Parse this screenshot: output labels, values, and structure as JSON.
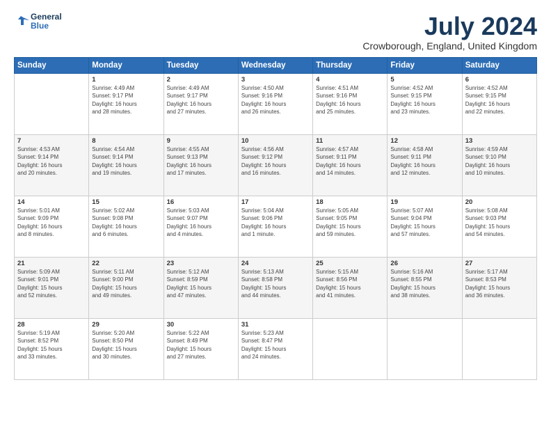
{
  "header": {
    "logo_line1": "General",
    "logo_line2": "Blue",
    "title": "July 2024",
    "subtitle": "Crowborough, England, United Kingdom"
  },
  "columns": [
    "Sunday",
    "Monday",
    "Tuesday",
    "Wednesday",
    "Thursday",
    "Friday",
    "Saturday"
  ],
  "weeks": [
    [
      {
        "day": "",
        "info": ""
      },
      {
        "day": "1",
        "info": "Sunrise: 4:49 AM\nSunset: 9:17 PM\nDaylight: 16 hours\nand 28 minutes."
      },
      {
        "day": "2",
        "info": "Sunrise: 4:49 AM\nSunset: 9:17 PM\nDaylight: 16 hours\nand 27 minutes."
      },
      {
        "day": "3",
        "info": "Sunrise: 4:50 AM\nSunset: 9:16 PM\nDaylight: 16 hours\nand 26 minutes."
      },
      {
        "day": "4",
        "info": "Sunrise: 4:51 AM\nSunset: 9:16 PM\nDaylight: 16 hours\nand 25 minutes."
      },
      {
        "day": "5",
        "info": "Sunrise: 4:52 AM\nSunset: 9:15 PM\nDaylight: 16 hours\nand 23 minutes."
      },
      {
        "day": "6",
        "info": "Sunrise: 4:52 AM\nSunset: 9:15 PM\nDaylight: 16 hours\nand 22 minutes."
      }
    ],
    [
      {
        "day": "7",
        "info": "Sunrise: 4:53 AM\nSunset: 9:14 PM\nDaylight: 16 hours\nand 20 minutes."
      },
      {
        "day": "8",
        "info": "Sunrise: 4:54 AM\nSunset: 9:14 PM\nDaylight: 16 hours\nand 19 minutes."
      },
      {
        "day": "9",
        "info": "Sunrise: 4:55 AM\nSunset: 9:13 PM\nDaylight: 16 hours\nand 17 minutes."
      },
      {
        "day": "10",
        "info": "Sunrise: 4:56 AM\nSunset: 9:12 PM\nDaylight: 16 hours\nand 16 minutes."
      },
      {
        "day": "11",
        "info": "Sunrise: 4:57 AM\nSunset: 9:11 PM\nDaylight: 16 hours\nand 14 minutes."
      },
      {
        "day": "12",
        "info": "Sunrise: 4:58 AM\nSunset: 9:11 PM\nDaylight: 16 hours\nand 12 minutes."
      },
      {
        "day": "13",
        "info": "Sunrise: 4:59 AM\nSunset: 9:10 PM\nDaylight: 16 hours\nand 10 minutes."
      }
    ],
    [
      {
        "day": "14",
        "info": "Sunrise: 5:01 AM\nSunset: 9:09 PM\nDaylight: 16 hours\nand 8 minutes."
      },
      {
        "day": "15",
        "info": "Sunrise: 5:02 AM\nSunset: 9:08 PM\nDaylight: 16 hours\nand 6 minutes."
      },
      {
        "day": "16",
        "info": "Sunrise: 5:03 AM\nSunset: 9:07 PM\nDaylight: 16 hours\nand 4 minutes."
      },
      {
        "day": "17",
        "info": "Sunrise: 5:04 AM\nSunset: 9:06 PM\nDaylight: 16 hours\nand 1 minute."
      },
      {
        "day": "18",
        "info": "Sunrise: 5:05 AM\nSunset: 9:05 PM\nDaylight: 15 hours\nand 59 minutes."
      },
      {
        "day": "19",
        "info": "Sunrise: 5:07 AM\nSunset: 9:04 PM\nDaylight: 15 hours\nand 57 minutes."
      },
      {
        "day": "20",
        "info": "Sunrise: 5:08 AM\nSunset: 9:03 PM\nDaylight: 15 hours\nand 54 minutes."
      }
    ],
    [
      {
        "day": "21",
        "info": "Sunrise: 5:09 AM\nSunset: 9:01 PM\nDaylight: 15 hours\nand 52 minutes."
      },
      {
        "day": "22",
        "info": "Sunrise: 5:11 AM\nSunset: 9:00 PM\nDaylight: 15 hours\nand 49 minutes."
      },
      {
        "day": "23",
        "info": "Sunrise: 5:12 AM\nSunset: 8:59 PM\nDaylight: 15 hours\nand 47 minutes."
      },
      {
        "day": "24",
        "info": "Sunrise: 5:13 AM\nSunset: 8:58 PM\nDaylight: 15 hours\nand 44 minutes."
      },
      {
        "day": "25",
        "info": "Sunrise: 5:15 AM\nSunset: 8:56 PM\nDaylight: 15 hours\nand 41 minutes."
      },
      {
        "day": "26",
        "info": "Sunrise: 5:16 AM\nSunset: 8:55 PM\nDaylight: 15 hours\nand 38 minutes."
      },
      {
        "day": "27",
        "info": "Sunrise: 5:17 AM\nSunset: 8:53 PM\nDaylight: 15 hours\nand 36 minutes."
      }
    ],
    [
      {
        "day": "28",
        "info": "Sunrise: 5:19 AM\nSunset: 8:52 PM\nDaylight: 15 hours\nand 33 minutes."
      },
      {
        "day": "29",
        "info": "Sunrise: 5:20 AM\nSunset: 8:50 PM\nDaylight: 15 hours\nand 30 minutes."
      },
      {
        "day": "30",
        "info": "Sunrise: 5:22 AM\nSunset: 8:49 PM\nDaylight: 15 hours\nand 27 minutes."
      },
      {
        "day": "31",
        "info": "Sunrise: 5:23 AM\nSunset: 8:47 PM\nDaylight: 15 hours\nand 24 minutes."
      },
      {
        "day": "",
        "info": ""
      },
      {
        "day": "",
        "info": ""
      },
      {
        "day": "",
        "info": ""
      }
    ]
  ]
}
